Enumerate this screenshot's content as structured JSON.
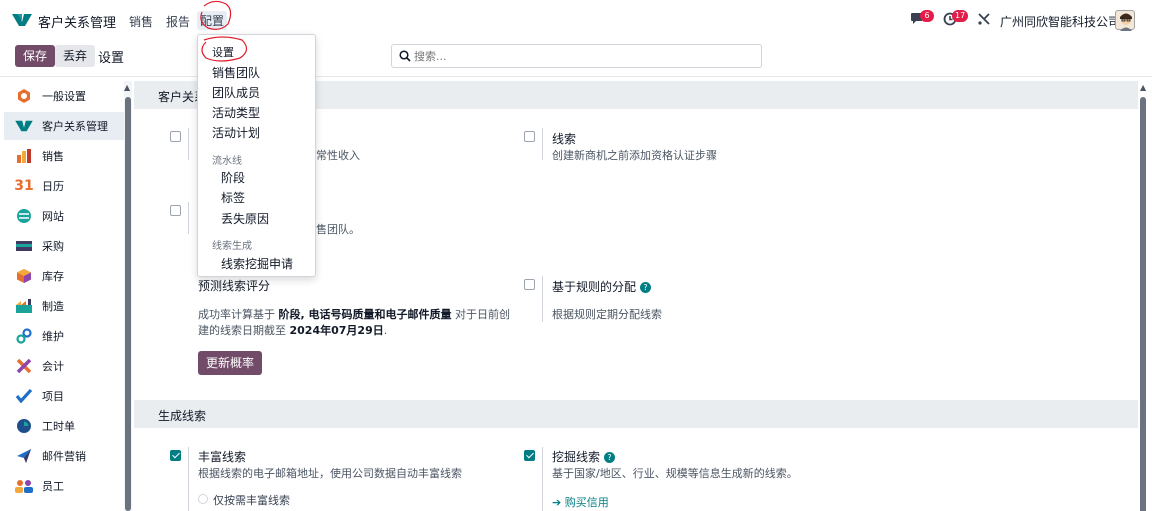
{
  "navbar": {
    "app_title": "客户关系管理",
    "menu": [
      "销售",
      "报告",
      "配置"
    ],
    "messages_count": "6",
    "activities_count": "17",
    "company": "广州同欣智能科技公司"
  },
  "control_panel": {
    "save_label": "保存",
    "discard_label": "丢弃",
    "page_title": "设置",
    "search_placeholder": "搜索..."
  },
  "sidebar": {
    "items": [
      {
        "label": "一般设置",
        "icon": "settings-icon"
      },
      {
        "label": "客户关系管理",
        "icon": "crm-icon"
      },
      {
        "label": "销售",
        "icon": "sales-icon"
      },
      {
        "label": "日历",
        "icon": "calendar-icon",
        "glyph": "31"
      },
      {
        "label": "网站",
        "icon": "website-icon"
      },
      {
        "label": "采购",
        "icon": "purchase-icon"
      },
      {
        "label": "库存",
        "icon": "inventory-icon"
      },
      {
        "label": "制造",
        "icon": "manufacturing-icon"
      },
      {
        "label": "维护",
        "icon": "maintenance-icon"
      },
      {
        "label": "会计",
        "icon": "accounting-icon"
      },
      {
        "label": "项目",
        "icon": "project-icon"
      },
      {
        "label": "工时单",
        "icon": "timesheet-icon"
      },
      {
        "label": "邮件营销",
        "icon": "email-marketing-icon"
      },
      {
        "label": "员工",
        "icon": "employees-icon"
      }
    ]
  },
  "dropdown": {
    "items_top": [
      "设置",
      "销售团队",
      "团队成员",
      "活动类型",
      "活动计划"
    ],
    "pipeline_header": "流水线",
    "pipeline_items": [
      "阶段",
      "标签",
      "丢失原因"
    ],
    "lead_gen_header": "线索生成",
    "lead_gen_items": [
      "线索挖掘申请"
    ]
  },
  "sections": {
    "crm_header": "客户关系",
    "recurring_desc_fragment": "常性收入",
    "leads_title": "线索",
    "leads_desc": "创建新商机之前添加资格认证步骤",
    "teams_desc_fragment": "售团队。",
    "predictive_title": "预测线索评分",
    "predictive_desc_1": "成功率计算基于",
    "predictive_desc_bold": "阶段, 电话号码质量和电子邮件质量",
    "predictive_desc_2": "对于日前创",
    "predictive_desc_3": "建的线索日期截至",
    "predictive_date": "2024年07月29日",
    "predictive_desc_end": ".",
    "update_button": "更新概率",
    "rule_title": "基于规则的分配",
    "rule_desc": "根据规则定期分配线索",
    "lead_gen_header": "生成线索",
    "enrich_title": "丰富线索",
    "enrich_desc": "根据线索的电子邮箱地址，使用公司数据自动丰富线索",
    "enrich_option": "仅按需丰富线索",
    "mining_title": "挖掘线索",
    "mining_desc": "基于国家/地区、行业、规模等信息生成新的线索。",
    "buy_credits": "➔ 购买信用"
  },
  "colors": {
    "primary": "#714b67",
    "teal": "#017e84",
    "badge": "#e11d48"
  }
}
